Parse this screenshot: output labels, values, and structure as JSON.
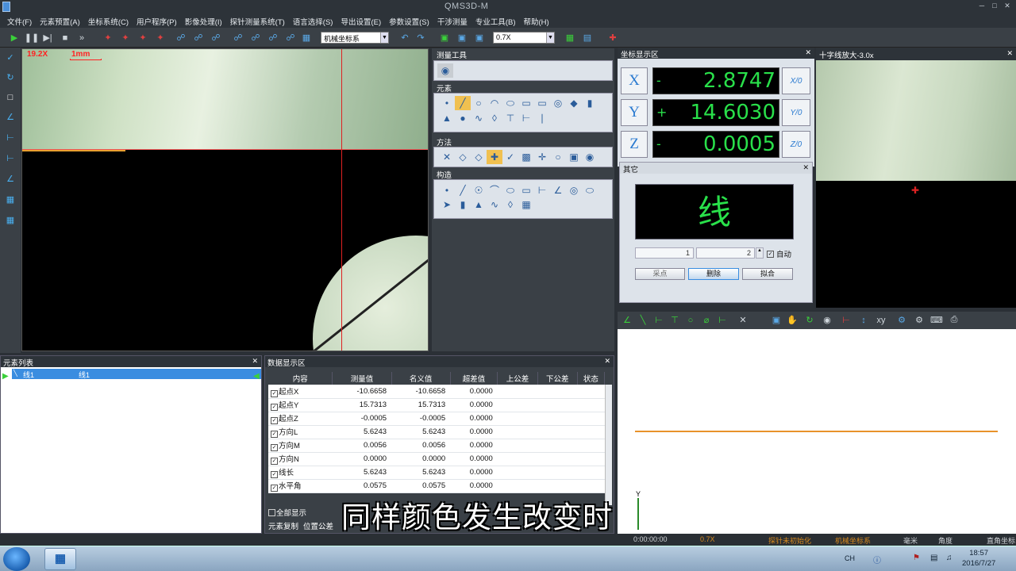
{
  "app": {
    "title": "QMS3D-M"
  },
  "menu": [
    "文件(F)",
    "元素预置(A)",
    "坐标系统(C)",
    "用户程序(P)",
    "影像处理(I)",
    "探针测量系统(T)",
    "语言选择(S)",
    "导出设置(E)",
    "参数设置(S)",
    "干涉测量",
    "专业工具(B)",
    "帮助(H)"
  ],
  "toolbar": {
    "coord_combo": "机械坐标系",
    "zoom_combo": "0.7X"
  },
  "camera": {
    "zoom_label": "19.2X",
    "scale_label": "1mm"
  },
  "tools_panel": {
    "title": "测量工具",
    "elements_title": "元素",
    "method_title": "方法",
    "construct_title": "构造"
  },
  "coord_panel": {
    "title": "坐标显示区",
    "x": {
      "axis": "X",
      "sign": "-",
      "value": "2.8747",
      "zero": "X/0"
    },
    "y": {
      "axis": "Y",
      "sign": "+",
      "value": "14.6030",
      "zero": "Y/0"
    },
    "z": {
      "axis": "Z",
      "sign": "-",
      "value": "0.0005",
      "zero": "Z/0"
    }
  },
  "other_panel": {
    "title": "其它",
    "element_char": "线",
    "field1": "1",
    "field2": "2",
    "auto_label": "自动",
    "btn_sample": "采点",
    "btn_delete": "删除",
    "btn_fit": "拟合"
  },
  "zoom_panel": {
    "title": "十字线放大-3.0x"
  },
  "element_list": {
    "title": "元素列表",
    "row_name": "线1",
    "row_desc": "线1"
  },
  "data_panel": {
    "title": "数据显示区",
    "columns": [
      "内容",
      "测量值",
      "名义值",
      "超差值",
      "上公差",
      "下公差",
      "状态"
    ],
    "rows": [
      {
        "name": "起点X",
        "measured": "-10.6658",
        "nominal": "-10.6658",
        "dev": "0.0000"
      },
      {
        "name": "起点Y",
        "measured": "15.7313",
        "nominal": "15.7313",
        "dev": "0.0000"
      },
      {
        "name": "起点Z",
        "measured": "-0.0005",
        "nominal": "-0.0005",
        "dev": "0.0000"
      },
      {
        "name": "方向L",
        "measured": "5.6243",
        "nominal": "5.6243",
        "dev": "0.0000"
      },
      {
        "name": "方向M",
        "measured": "0.0056",
        "nominal": "0.0056",
        "dev": "0.0000"
      },
      {
        "name": "方向N",
        "measured": "0.0000",
        "nominal": "0.0000",
        "dev": "0.0000"
      },
      {
        "name": "线长",
        "measured": "5.6243",
        "nominal": "5.6243",
        "dev": "0.0000"
      },
      {
        "name": "水平角",
        "measured": "0.0575",
        "nominal": "0.0575",
        "dev": "0.0000"
      }
    ],
    "show_all": "全部显示",
    "tabs": [
      "元素复制",
      "位置公差"
    ]
  },
  "graph": {
    "axis_label": "Y"
  },
  "status": {
    "time": "0:00:00:00",
    "zoom": "0.7X",
    "probe": "探针未初始化",
    "coord": "机械坐标系",
    "unit": "毫米",
    "angle": "角度",
    "coord_type": "直角坐标"
  },
  "taskbar": {
    "lang": "CH",
    "time": "18:57",
    "date": "2016/7/27"
  },
  "subtitle": "同样颜色发生改变时"
}
